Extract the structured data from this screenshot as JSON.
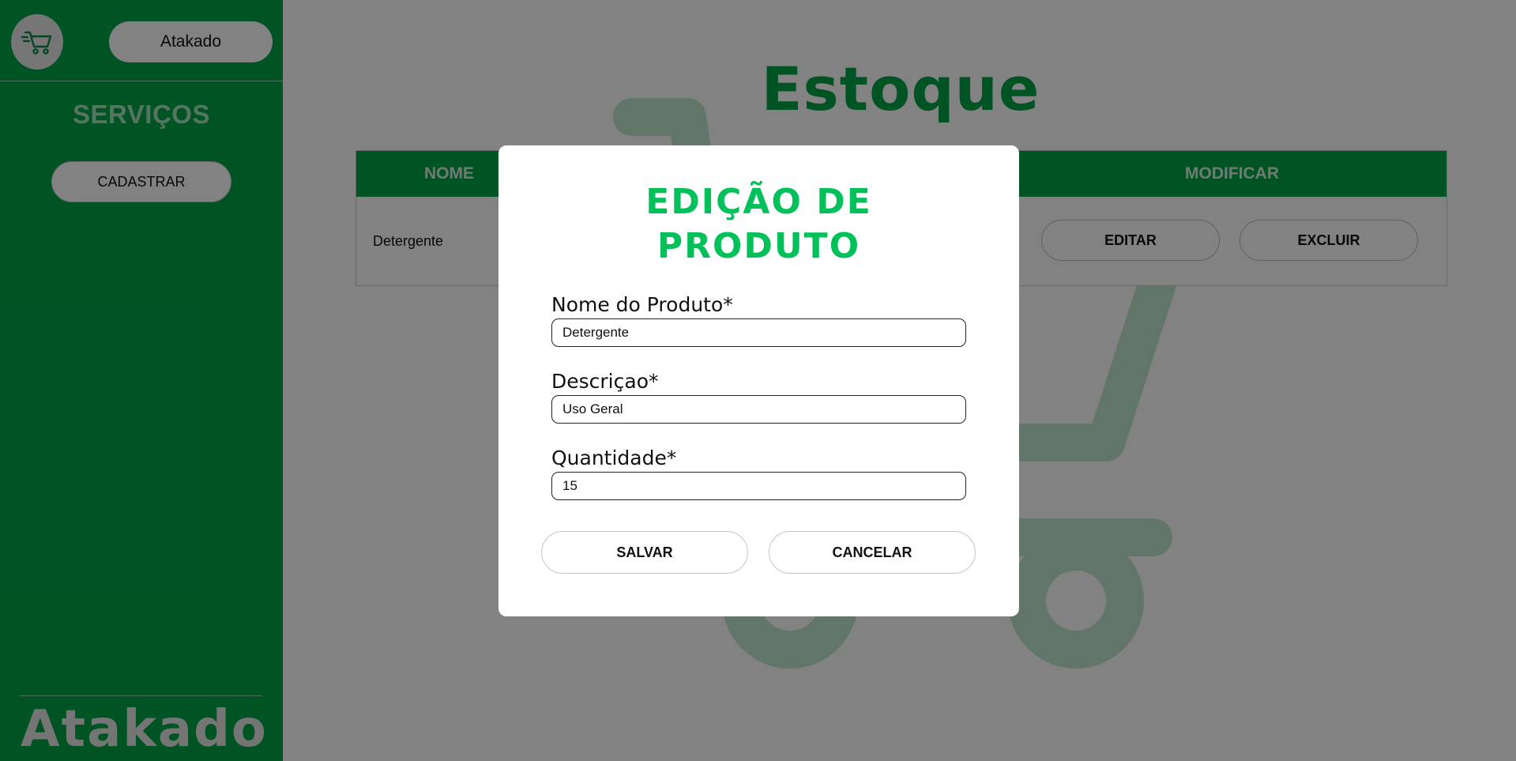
{
  "sidebar": {
    "brand_label": "Atakado",
    "services_title": "SERVIÇOS",
    "register_label": "CADASTRAR",
    "footer_logo": "Atakado"
  },
  "main": {
    "title": "Estoque",
    "table": {
      "columns": [
        "NOME",
        "MODIFICAR"
      ],
      "rows": [
        {
          "name": "Detergente",
          "edit_label": "EDITAR",
          "delete_label": "EXCLUIR"
        }
      ]
    }
  },
  "modal": {
    "title_line1": "EDIÇÃO DE",
    "title_line2": "PRODUTO",
    "fields": [
      {
        "label": "Nome do Produto*",
        "value": "Detergente"
      },
      {
        "label": "Descriçao*",
        "value": "Uso Geral"
      },
      {
        "label": "Quantidade*",
        "value": "15"
      }
    ],
    "save_label": "SALVAR",
    "cancel_label": "CANCELAR"
  },
  "colors": {
    "brand_green": "#00a548",
    "modal_title_green": "#00c059"
  },
  "icons": {
    "logo": "shopping-cart-icon",
    "watermark": "shopping-cart-icon"
  }
}
